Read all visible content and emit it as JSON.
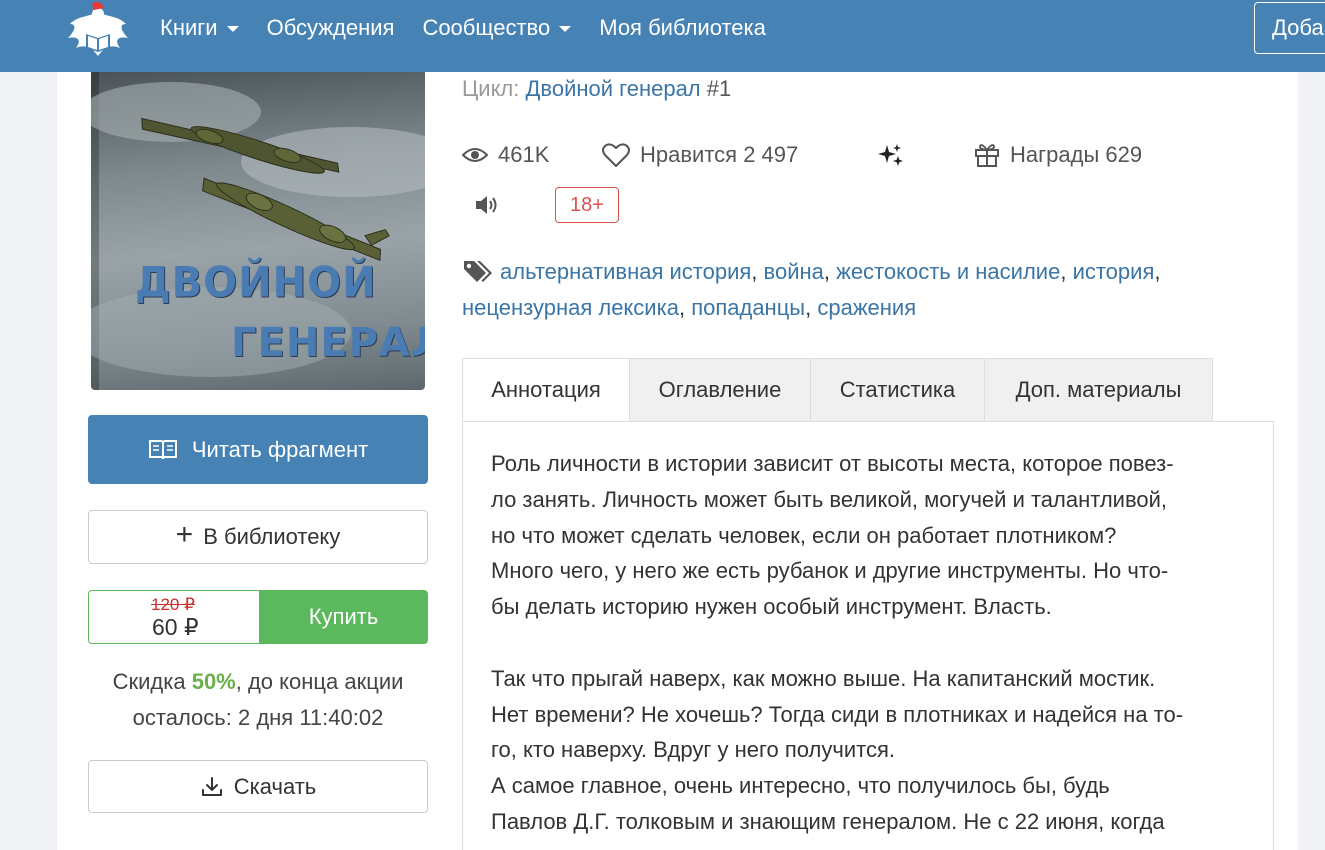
{
  "nav": {
    "items": [
      {
        "label": "Книги",
        "dropdown": true
      },
      {
        "label": "Обсуждения",
        "dropdown": false
      },
      {
        "label": "Сообщество",
        "dropdown": true
      },
      {
        "label": "Моя библиотека",
        "dropdown": false
      }
    ],
    "add_label": "Доба"
  },
  "book": {
    "cover_line1": "ДВОЙНОЙ",
    "cover_line2": "ГЕНЕРАЛ",
    "cycle_label": "Цикл:",
    "cycle_name": "Двойной генерал",
    "cycle_number": "#1"
  },
  "stats": {
    "views": "461K",
    "likes_label": "Нравится",
    "likes": "2 497",
    "awards_label": "Награды",
    "awards": "629",
    "age_rating": "18+"
  },
  "tags": [
    "альтернативная история",
    "война",
    "жестокость и насилие",
    "история",
    "нецензурная лексика",
    "попаданцы",
    "сражения"
  ],
  "actions": {
    "read_fragment": "Читать фрагмент",
    "add_library": "В библиотеку",
    "old_price": "120 ₽",
    "new_price": "60 ₽",
    "buy": "Купить",
    "discount_prefix": "Скидка",
    "discount_pct": "50%",
    "discount_suffix": ", до конца акции",
    "remaining_prefix": "осталось:",
    "remaining_time": "2 дня 11:40:02",
    "download": "Скачать"
  },
  "tabs": [
    "Аннотация",
    "Оглавление",
    "Статистика",
    "Доп. материалы"
  ],
  "annotation_lines": [
    "Роль личности в истории зависит от высоты места, которое повез-",
    "ло занять. Личность может быть великой, могучей и талантливой,",
    "но что может сделать человек, если он работает плотником?",
    "Много чего, у него же есть рубанок и другие инструменты. Но что-",
    "бы делать историю нужен особый инструмент. Власть.",
    "",
    "Так что прыгай наверх, как можно выше. На капитанский мостик.",
    "Нет времени? Не хочешь? Тогда сиди в плотниках и надейся на то-",
    "го, кто наверху. Вдруг у него получится.",
    "А самое главное, очень интересно, что получилось бы, будь",
    "Павлов Д.Г. толковым и знающим генералом. Не с 22 июня, когда"
  ]
}
